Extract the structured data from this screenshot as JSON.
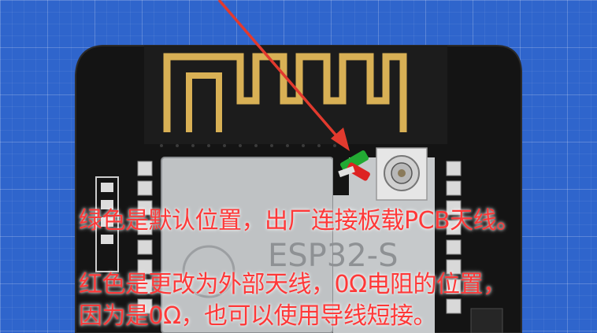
{
  "image": {
    "subject": "ESP32-S module on a development board",
    "module_label": "ESP32-S",
    "annotation_arrow_color": "#e23a2e"
  },
  "captions": {
    "line1": "绿色是默认位置，出厂连接板载PCB天线。",
    "line2": "红色是更改为外部天线，0Ω电阻的位置，",
    "line3": "因为是0Ω，也可以使用导线短接。"
  },
  "colors": {
    "caption": "#ff3838",
    "background_grid": "#2f65cc",
    "board": "#141414",
    "antenna_trace": "#d8b055",
    "marker_green": "#22aa33",
    "marker_red": "#dd2222"
  }
}
